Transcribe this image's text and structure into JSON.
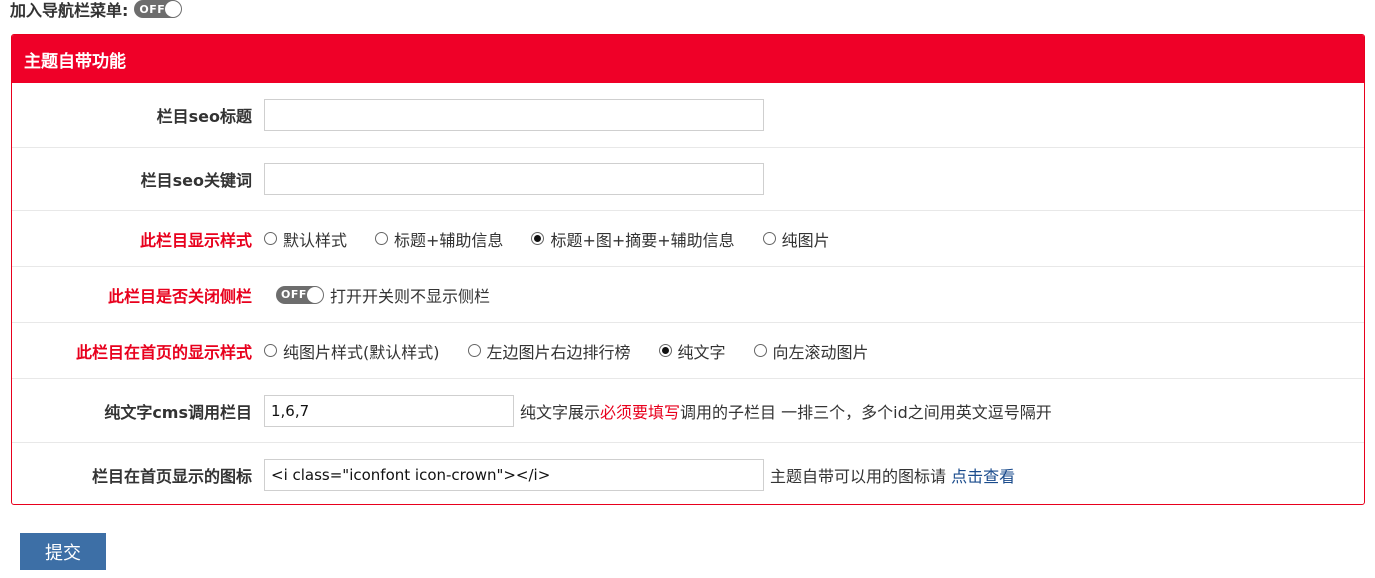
{
  "top": {
    "label": "加入导航栏菜单:",
    "toggle_text": "OFF"
  },
  "panel": {
    "title": "主题自带功能",
    "rows": {
      "seo_title": {
        "label": "栏目seo标题",
        "value": ""
      },
      "seo_keywords": {
        "label": "栏目seo关键词",
        "value": ""
      },
      "display_style": {
        "label": "此栏目显示样式",
        "options": [
          "默认样式",
          "标题+辅助信息",
          "标题+图+摘要+辅助信息",
          "纯图片"
        ],
        "selected": "标题+图+摘要+辅助信息"
      },
      "close_sidebar": {
        "label": "此栏目是否关闭侧栏",
        "toggle_text": "OFF",
        "hint": "打开开关则不显示侧栏"
      },
      "home_style": {
        "label": "此栏目在首页的显示样式",
        "options": [
          "纯图片样式(默认样式)",
          "左边图片右边排行榜",
          "纯文字",
          "向左滚动图片"
        ],
        "selected": "纯文字"
      },
      "cms_columns": {
        "label": "纯文字cms调用栏目",
        "value": "1,6,7",
        "hint_pre": "纯文字展示",
        "hint_em": "必须要填写",
        "hint_post": "调用的子栏目 一排三个，多个id之间用英文逗号隔开"
      },
      "home_icon": {
        "label": "栏目在首页显示的图标",
        "value": "<i class=\"iconfont icon-crown\"></i>",
        "hint": "主题自带可以用的图标请",
        "link": "点击查看"
      }
    }
  },
  "submit_label": "提交"
}
